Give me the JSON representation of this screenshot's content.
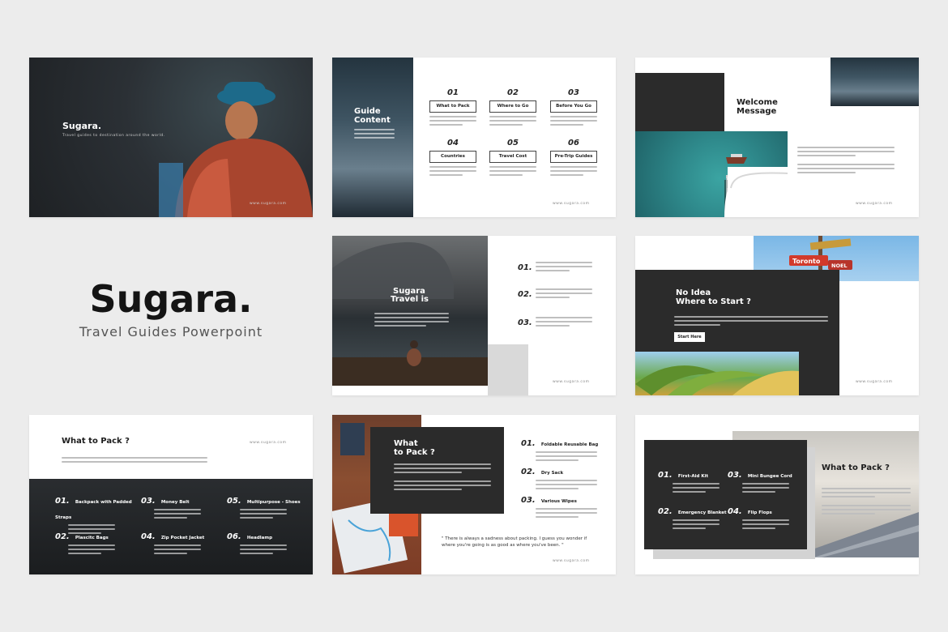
{
  "brand": {
    "title": "Sugara.",
    "subtitle": "Travel Guides Powerpoint"
  },
  "colors": {
    "dark": "#2b2b2b",
    "bg": "#ececec",
    "text": "#1d1d1d"
  },
  "website": "www.sugara.com",
  "s1": {
    "title": "Sugara.",
    "tagline": "Travel guides to destination around the world."
  },
  "s2": {
    "title_l1": "Guide",
    "title_l2": "Content",
    "items": [
      {
        "num": "01",
        "label": "What to Pack"
      },
      {
        "num": "02",
        "label": "Where to Go"
      },
      {
        "num": "03",
        "label": "Before You Go"
      },
      {
        "num": "04",
        "label": "Countries"
      },
      {
        "num": "05",
        "label": "Travel Cost"
      },
      {
        "num": "06",
        "label": "Pre-Trip Guides"
      }
    ]
  },
  "s3": {
    "title_l1": "Welcome",
    "title_l2": "Message"
  },
  "s4": {
    "title_l1": "Sugara",
    "title_l2": "Travel is",
    "nums": [
      "01.",
      "02.",
      "03."
    ]
  },
  "s5": {
    "title_l1": "No Idea",
    "title_l2": "Where to Start ?",
    "button": "Start Here",
    "sign1": "Toronto",
    "sign2": "NOEL"
  },
  "s6": {
    "title": "What to Pack ?",
    "items": [
      {
        "num": "01.",
        "label": "Backpack with Padded Straps"
      },
      {
        "num": "03.",
        "label": "Money Belt"
      },
      {
        "num": "05.",
        "label": "Multipurpose - Shoes"
      },
      {
        "num": "02.",
        "label": "Plascitc Bags"
      },
      {
        "num": "04.",
        "label": "Zip Pocket Jacket"
      },
      {
        "num": "06.",
        "label": "Headlamp"
      }
    ]
  },
  "s7": {
    "title_l1": "What",
    "title_l2": "to Pack ?",
    "items": [
      {
        "num": "01.",
        "label": "Foldable Reusable Bag"
      },
      {
        "num": "02.",
        "label": "Dry Sack"
      },
      {
        "num": "03.",
        "label": "Various Wipes"
      }
    ],
    "quote": "\" There is always a sadness about packing. I guess you wonder if where you're going is as good as where you've been. \""
  },
  "s8": {
    "title": "What to Pack ?",
    "items": [
      {
        "num": "01.",
        "label": "First-Aid Kit"
      },
      {
        "num": "03.",
        "label": "Mini Bungee Cord"
      },
      {
        "num": "02.",
        "label": "Emergency Blanket"
      },
      {
        "num": "04.",
        "label": "Flip Flops"
      }
    ]
  }
}
